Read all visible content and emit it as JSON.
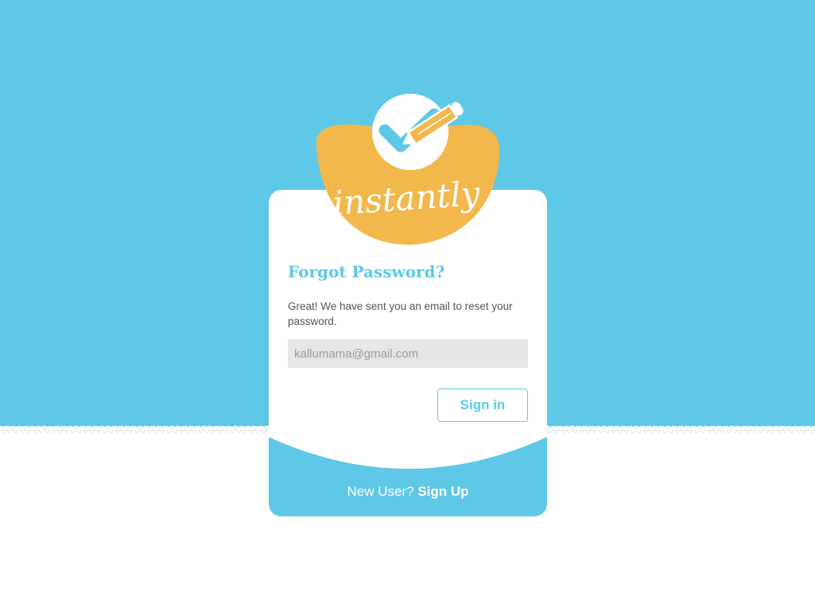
{
  "colors": {
    "accent": "#5ec8e6",
    "brand": "#f2b84b",
    "input_bg": "#e6e6e6"
  },
  "logo": {
    "text": "instantly",
    "icons": [
      "checkmark-icon",
      "pencil-icon"
    ]
  },
  "form": {
    "title": "Forgot Password?",
    "message": "Great! We have sent you an email to reset your password.",
    "email_placeholder": "kallumama@gmail.com",
    "signin_label": "Sign in"
  },
  "footer": {
    "prompt": "New User?",
    "signup_label": "Sign Up"
  }
}
